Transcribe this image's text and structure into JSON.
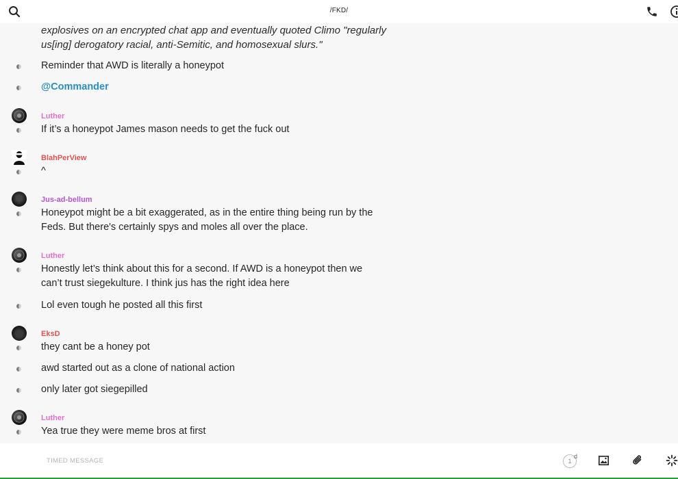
{
  "header": {
    "title": "/FKD/",
    "icons": [
      "search-icon",
      "phone-icon",
      "info-icon"
    ]
  },
  "chat": {
    "quote": "explosives on an encrypted chat app and eventually quoted Climo \"regularly us[ing] derogatory racial, anti-Semitic, and homosexual slurs.\"",
    "messages": [
      {
        "text": "Reminder that AWD is literally a honeypot"
      },
      {
        "text": "@Commander"
      },
      {
        "author": "Luther",
        "text": "If it’s a honeypot James mason needs to get the fuck out"
      },
      {
        "author": "BlahPerView",
        "text": "^"
      },
      {
        "author": "Jus-ad-bellum",
        "text": "Honeypot might be a bit exaggerated, as in the entire thing being run by the Feds. But there's certainly spys and moles all over the place."
      },
      {
        "author": "Luther",
        "text": "Honestly let’s think about this for a second. If AWD is a honeypot then we can’t trust siegekulture. I think jus has the right idea here"
      },
      {
        "text": "Lol even tough he posted all this first"
      },
      {
        "author": "EksD",
        "text": "they cant be a honey pot"
      },
      {
        "text": "awd started out as a clone of national action"
      },
      {
        "text": "only later got siegepilled"
      },
      {
        "author": "Luther",
        "text": "Yea true they were meme bros at first"
      }
    ],
    "author_colors": {
      "Luther": "#e071c8",
      "BlahPerView": "#d9544f",
      "Jus-ad-bellum": "#b455d6",
      "EksD": "#d9544f"
    }
  },
  "footer": {
    "placeholder": "TIMED MESSAGE",
    "timer_value": "1",
    "timer_unit": "d",
    "icons": [
      "timer-icon",
      "image-icon",
      "paperclip-icon",
      "sparkle-icon"
    ]
  }
}
